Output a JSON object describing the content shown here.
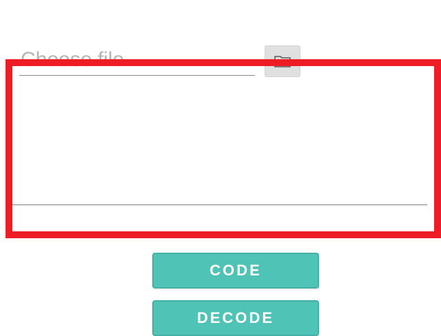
{
  "file_input": {
    "placeholder": "Choose file..."
  },
  "folder_button": {
    "icon": "folder-icon"
  },
  "buttons": {
    "code_label": "CODE",
    "decode_label": "DECODE"
  },
  "colors": {
    "accent": "#4fc3b5",
    "highlight": "#ee1c25"
  }
}
